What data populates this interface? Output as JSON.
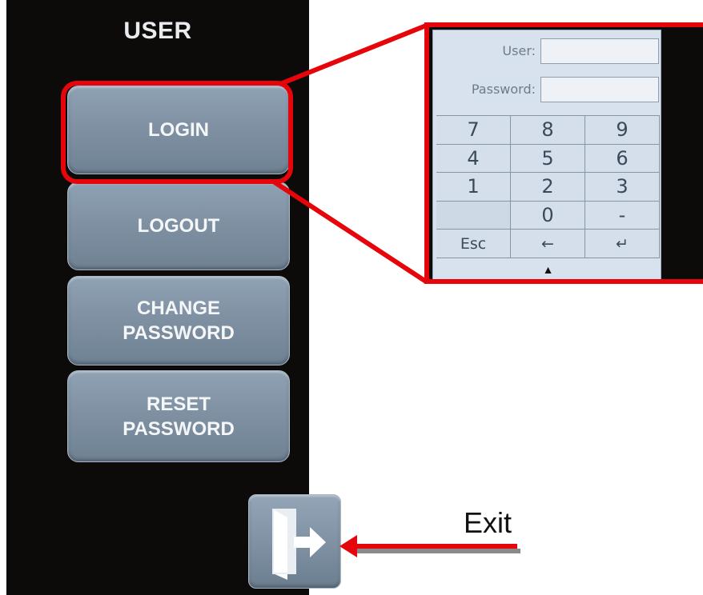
{
  "panel": {
    "title": "USER",
    "buttons": {
      "login": "LOGIN",
      "logout": "LOGOUT",
      "change_password": "CHANGE\nPASSWORD",
      "reset_password": "RESET\nPASSWORD"
    },
    "exit_icon": "exit-door-arrow-icon"
  },
  "login_dialog": {
    "user_label": "User:",
    "user_value": "",
    "password_label": "Password:",
    "password_value": "",
    "keys": [
      "7",
      "8",
      "9",
      "4",
      "5",
      "6",
      "1",
      "2",
      "3",
      "",
      "0",
      "-",
      "Esc",
      "←",
      "↵"
    ],
    "toggle_icon": "▲"
  },
  "annotation": {
    "exit_label": "Exit"
  },
  "colors": {
    "highlight": "#e5050a",
    "button": "#7f91a3",
    "panel_bg": "#0d0b0a"
  }
}
